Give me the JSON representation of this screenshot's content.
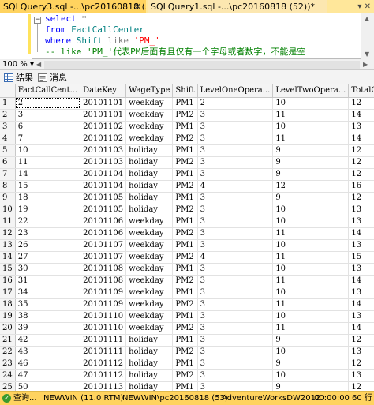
{
  "tabs": [
    {
      "label": "SQLQuery3.sql -...\\pc20160818 (53))*",
      "close": "✕",
      "active": true
    },
    {
      "label": "SQLQuery1.sql -...\\pc20160818 (52))*",
      "close": "",
      "active": false
    }
  ],
  "tab_tools": "▾ ✕",
  "editor": {
    "lines": [
      [
        {
          "t": "select ",
          "c": "kw"
        },
        {
          "t": "*",
          "c": "op"
        }
      ],
      [
        {
          "t": "from ",
          "c": "kw"
        },
        {
          "t": "FactCallCenter",
          "c": "ob"
        }
      ],
      [
        {
          "t": "where ",
          "c": "kw"
        },
        {
          "t": "Shift ",
          "c": "ob"
        },
        {
          "t": "like ",
          "c": "op"
        },
        {
          "t": "'PM_'",
          "c": "str"
        }
      ],
      [
        {
          "t": "-- like 'PM_'代表PM后面有且仅有一个字母或者数字，不能是空",
          "c": "cm"
        }
      ]
    ]
  },
  "zoom": "100 %",
  "result_tabs": {
    "results": "结果",
    "messages": "消息"
  },
  "grid": {
    "columns": [
      "FactCallCent...",
      "DateKey",
      "WageType",
      "Shift",
      "LevelOneOpera...",
      "LevelTwoOpera...",
      "TotalOpe"
    ],
    "rows": [
      [
        "2",
        "20101101",
        "weekday",
        "PM1",
        "2",
        "10",
        "12"
      ],
      [
        "3",
        "20101101",
        "weekday",
        "PM2",
        "3",
        "11",
        "14"
      ],
      [
        "6",
        "20101102",
        "weekday",
        "PM1",
        "3",
        "10",
        "13"
      ],
      [
        "7",
        "20101102",
        "weekday",
        "PM2",
        "3",
        "11",
        "14"
      ],
      [
        "10",
        "20101103",
        "holiday",
        "PM1",
        "3",
        "9",
        "12"
      ],
      [
        "11",
        "20101103",
        "holiday",
        "PM2",
        "3",
        "9",
        "12"
      ],
      [
        "14",
        "20101104",
        "holiday",
        "PM1",
        "3",
        "9",
        "12"
      ],
      [
        "15",
        "20101104",
        "holiday",
        "PM2",
        "4",
        "12",
        "16"
      ],
      [
        "18",
        "20101105",
        "holiday",
        "PM1",
        "3",
        "9",
        "12"
      ],
      [
        "19",
        "20101105",
        "holiday",
        "PM2",
        "3",
        "10",
        "13"
      ],
      [
        "22",
        "20101106",
        "weekday",
        "PM1",
        "3",
        "10",
        "13"
      ],
      [
        "23",
        "20101106",
        "weekday",
        "PM2",
        "3",
        "11",
        "14"
      ],
      [
        "26",
        "20101107",
        "weekday",
        "PM1",
        "3",
        "10",
        "13"
      ],
      [
        "27",
        "20101107",
        "weekday",
        "PM2",
        "4",
        "11",
        "15"
      ],
      [
        "30",
        "20101108",
        "weekday",
        "PM1",
        "3",
        "10",
        "13"
      ],
      [
        "31",
        "20101108",
        "weekday",
        "PM2",
        "3",
        "11",
        "14"
      ],
      [
        "34",
        "20101109",
        "weekday",
        "PM1",
        "3",
        "10",
        "13"
      ],
      [
        "35",
        "20101109",
        "weekday",
        "PM2",
        "3",
        "11",
        "14"
      ],
      [
        "38",
        "20101110",
        "weekday",
        "PM1",
        "3",
        "10",
        "13"
      ],
      [
        "39",
        "20101110",
        "weekday",
        "PM2",
        "3",
        "11",
        "14"
      ],
      [
        "42",
        "20101111",
        "holiday",
        "PM1",
        "3",
        "9",
        "12"
      ],
      [
        "43",
        "20101111",
        "holiday",
        "PM2",
        "3",
        "10",
        "13"
      ],
      [
        "46",
        "20101112",
        "holiday",
        "PM1",
        "3",
        "9",
        "12"
      ],
      [
        "47",
        "20101112",
        "holiday",
        "PM2",
        "3",
        "10",
        "13"
      ],
      [
        "50",
        "20101113",
        "holiday",
        "PM1",
        "3",
        "9",
        "12"
      ]
    ]
  },
  "status": {
    "query": "查询...",
    "server": "NEWWIN (11.0 RTM)",
    "login": "NEWWIN\\pc20160818 (53)",
    "database": "AdventureWorksDW2012",
    "time": "00:00:00",
    "rows": "60 行"
  },
  "colors": {
    "tab_active": "#ffd35f",
    "status_bar": "#ffd35f",
    "keyword": "#0000ff",
    "string": "#ff0000",
    "comment": "#008000"
  }
}
